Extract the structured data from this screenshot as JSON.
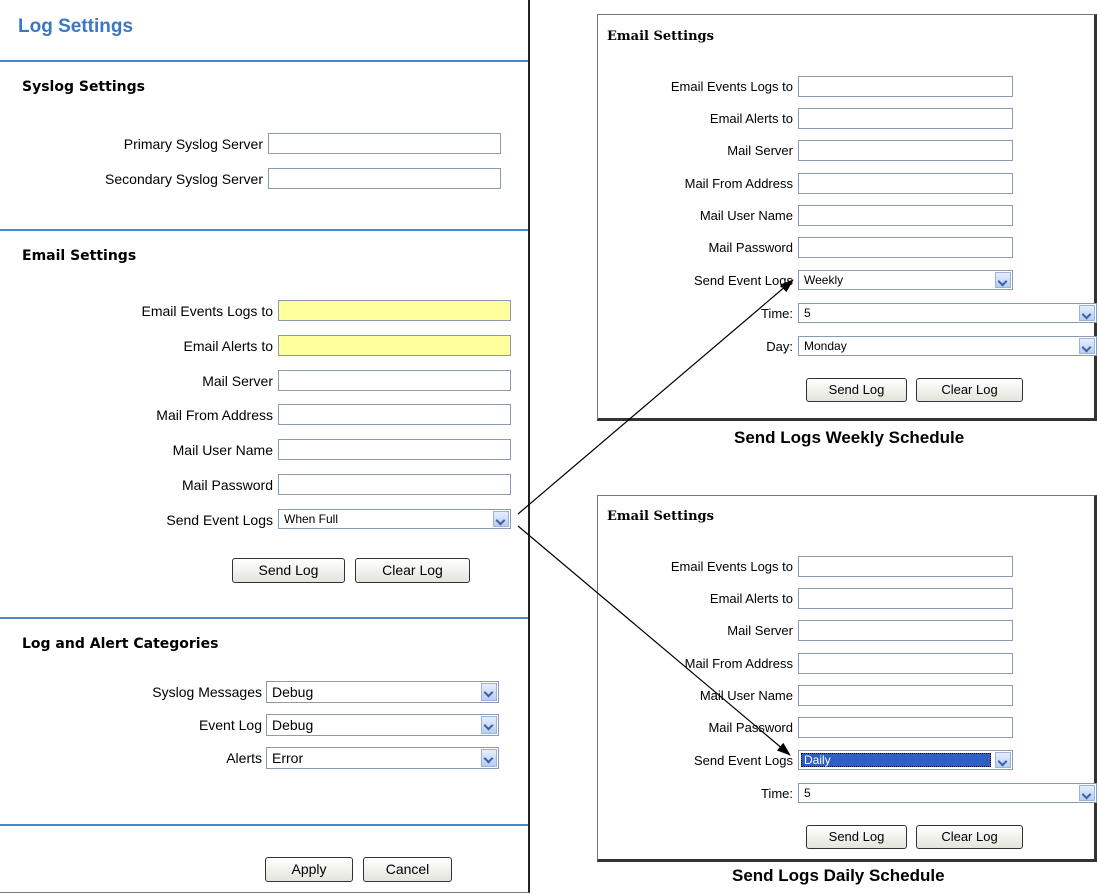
{
  "log_settings": {
    "title": "Log Settings",
    "syslog": {
      "title": "Syslog Settings",
      "primary_label": "Primary Syslog Server",
      "primary_value": "",
      "secondary_label": "Secondary Syslog Server",
      "secondary_value": ""
    },
    "email": {
      "title": "Email Settings",
      "events_label": "Email Events Logs to",
      "alerts_label": "Email Alerts to",
      "server_label": "Mail Server",
      "from_label": "Mail From Address",
      "user_label": "Mail User Name",
      "password_label": "Mail Password",
      "send_label": "Send Event Logs",
      "send_value": "When Full",
      "send_log_button": "Send Log",
      "clear_log_button": "Clear Log"
    },
    "categories": {
      "title": "Log and Alert Categories",
      "syslog_label": "Syslog Messages",
      "syslog_value": "Debug",
      "event_label": "Event Log",
      "event_value": "Debug",
      "alerts_label": "Alerts",
      "alerts_value": "Error"
    },
    "apply_button": "Apply",
    "cancel_button": "Cancel"
  },
  "weekly": {
    "title": "Email Settings",
    "events_label": "Email Events Logs to",
    "alerts_label": "Email Alerts to",
    "server_label": "Mail Server",
    "from_label": "Mail From Address",
    "user_label": "Mail User Name",
    "password_label": "Mail Password",
    "send_label": "Send Event Logs",
    "send_value": "Weekly",
    "time_label": "Time:",
    "time_value": "5",
    "day_label": "Day:",
    "day_value": "Monday",
    "send_log_button": "Send Log",
    "clear_log_button": "Clear Log",
    "caption": "Send Logs Weekly Schedule"
  },
  "daily": {
    "title": "Email Settings",
    "events_label": "Email Events Logs to",
    "alerts_label": "Email Alerts to",
    "server_label": "Mail Server",
    "from_label": "Mail From Address",
    "user_label": "Mail User Name",
    "password_label": "Mail Password",
    "send_label": "Send Event Logs",
    "send_value": "Daily",
    "time_label": "Time:",
    "time_value": "5",
    "send_log_button": "Send Log",
    "clear_log_button": "Clear Log",
    "caption": "Send Logs Daily Schedule"
  },
  "colors": {
    "title_blue": "#3a77c6",
    "rule_blue": "#4a86cf",
    "highlight_yellow": "#ffff9d",
    "selected_blue": "#2f5fc4"
  }
}
